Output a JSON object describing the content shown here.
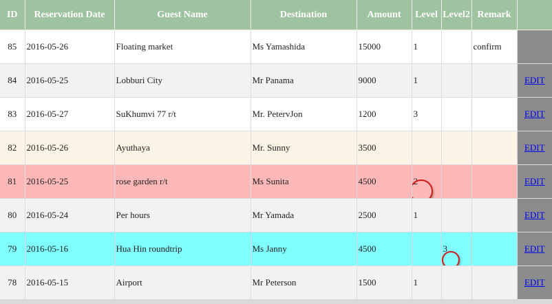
{
  "headers": [
    "ID",
    "Reservation Date",
    "Guest Name",
    "Destination",
    "Amount",
    "Level",
    "Level2",
    "Remark",
    ""
  ],
  "rows": [
    {
      "id": "85",
      "date": "2016-05-26",
      "guest": "Floating market",
      "dest": "Ms Yamashida",
      "amount": "15000",
      "level": "1",
      "level2": "",
      "remark": "confirm",
      "action": "",
      "bg": "#ffffff"
    },
    {
      "id": "84",
      "date": "2016-05-25",
      "guest": "Lobburi City",
      "dest": "Mr Panama",
      "amount": "9000",
      "level": "1",
      "level2": "",
      "remark": "",
      "action": "EDIT",
      "bg": "#f2f2f2"
    },
    {
      "id": "83",
      "date": "2016-05-27",
      "guest": "SuKhumvi 77 r/t",
      "dest": "Mr. PetervJon",
      "amount": "1200",
      "level": "3",
      "level2": "",
      "remark": "",
      "action": "EDIT",
      "bg": "#ffffff"
    },
    {
      "id": "82",
      "date": "2016-05-26",
      "guest": "Ayuthaya",
      "dest": "Mr. Sunny",
      "amount": "3500",
      "level": "",
      "level2": "",
      "remark": "",
      "action": "EDIT",
      "bg": "#fdf3e6"
    },
    {
      "id": "81",
      "date": "2016-05-25",
      "guest": "rose garden r/t",
      "dest": "Ms Sunita",
      "amount": "4500",
      "level": "2",
      "level2": "",
      "remark": "",
      "action": "EDIT",
      "bg": "#ffb8b8"
    },
    {
      "id": "80",
      "date": "2016-05-24",
      "guest": "Per hours",
      "dest": "Mr Yamada",
      "amount": "2500",
      "level": "1",
      "level2": "",
      "remark": "",
      "action": "EDIT",
      "bg": "#f2f2f2"
    },
    {
      "id": "79",
      "date": "2016-05-16",
      "guest": "Hua Hin roundtrip",
      "dest": "Ms Janny",
      "amount": "4500",
      "level": "",
      "level2": "3",
      "remark": "",
      "action": "EDIT",
      "bg": "#80ffff"
    },
    {
      "id": "78",
      "date": "2016-05-15",
      "guest": "Airport",
      "dest": "Mr Peterson",
      "amount": "1500",
      "level": "1",
      "level2": "",
      "remark": "",
      "action": "EDIT",
      "bg": "#f2f2f2"
    }
  ],
  "colors": {
    "header_bg": "#9fc2a0",
    "header_text": "#ffffff",
    "action_col_bg": "#8c8c8c",
    "link": "#0000ee",
    "annotation_circle": "#d01a1a"
  }
}
